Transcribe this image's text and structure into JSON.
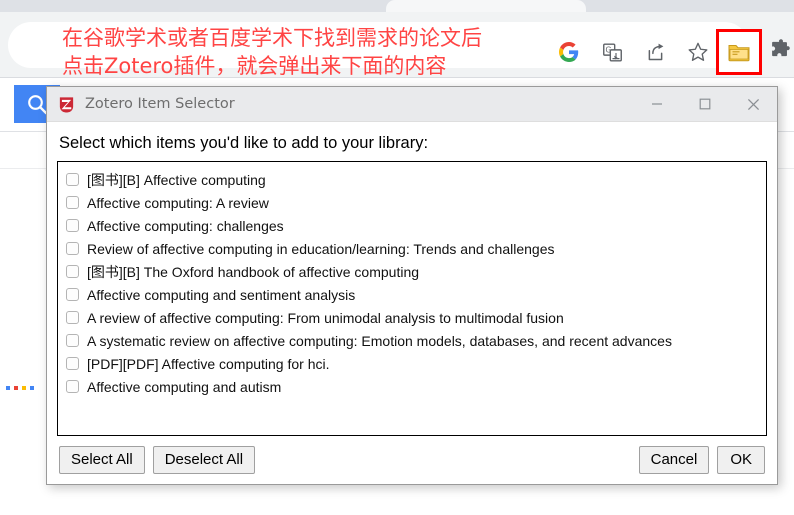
{
  "browser": {
    "annotation_text": "在谷歌学术或者百度学术下找到需求的论文后\n点击Zotero插件，就会弹出来下面的内容",
    "annotation_color": "#ff4444",
    "highlight_box_color": "#ff0000",
    "toolbar_icons": [
      {
        "name": "google-logo-icon",
        "label": "G"
      },
      {
        "name": "google-translate-icon",
        "label": ""
      },
      {
        "name": "share-icon",
        "label": ""
      },
      {
        "name": "bookmark-star-icon",
        "label": ""
      }
    ],
    "zotero_button": {
      "name": "zotero-connector-icon",
      "tooltip": "Save to Zotero"
    },
    "extensions_button": {
      "name": "extensions-puzzle-icon",
      "tooltip": "Extensions"
    }
  },
  "page": {
    "search_button_label": "",
    "search_button_color": "#4285f4",
    "pagination_dots_colors": [
      "#4285f4",
      "#ea4335",
      "#fbbc05",
      "#4285f4"
    ]
  },
  "dialog": {
    "title": "Zotero Item Selector",
    "logo_letter": "Z",
    "logo_color": "#cc2936",
    "window_controls": {
      "minimize": "minimize-button",
      "maximize": "maximize-button",
      "close": "close-button"
    },
    "prompt": "Select which items you'd like to add to your library:",
    "items": [
      {
        "label": "[图书][B] Affective computing",
        "checked": false
      },
      {
        "label": "Affective computing: A review",
        "checked": false
      },
      {
        "label": "Affective computing: challenges",
        "checked": false
      },
      {
        "label": "Review of affective computing in education/learning: Trends and challenges",
        "checked": false
      },
      {
        "label": "[图书][B] The Oxford handbook of affective computing",
        "checked": false
      },
      {
        "label": "Affective computing and sentiment analysis",
        "checked": false
      },
      {
        "label": "A review of affective computing: From unimodal analysis to multimodal fusion",
        "checked": false
      },
      {
        "label": "A systematic review on affective computing: Emotion models, databases, and recent advances",
        "checked": false
      },
      {
        "label": "[PDF][PDF] Affective computing for hci.",
        "checked": false
      },
      {
        "label": "Affective computing and autism",
        "checked": false
      }
    ],
    "buttons": {
      "select_all": "Select All",
      "deselect_all": "Deselect All",
      "cancel": "Cancel",
      "ok": "OK"
    }
  }
}
